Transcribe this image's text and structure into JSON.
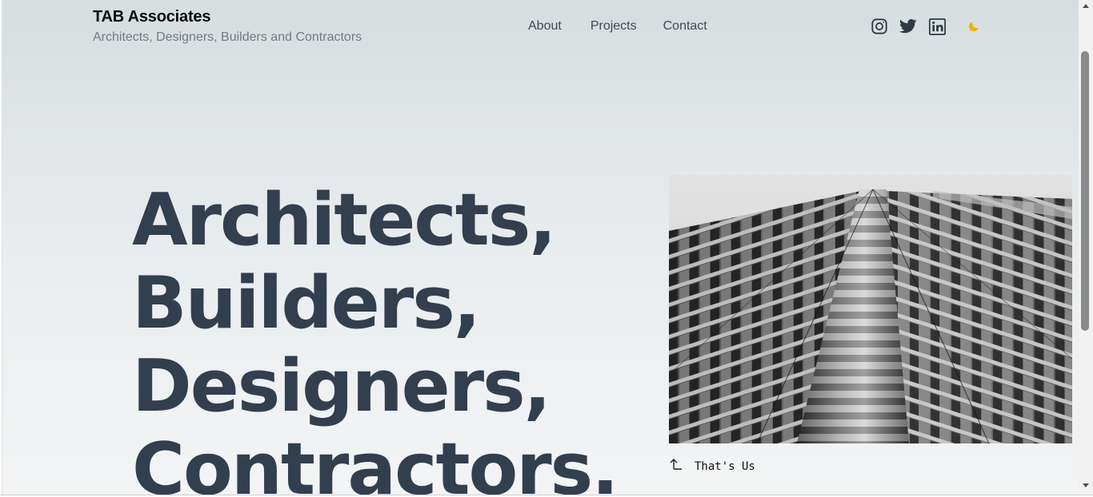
{
  "header": {
    "brand_name": "TAB Associates",
    "tagline": "Architects, Designers, Builders and Contractors"
  },
  "nav": {
    "items": [
      {
        "label": "About"
      },
      {
        "label": "Projects"
      },
      {
        "label": "Contact"
      }
    ]
  },
  "social": {
    "icons": [
      "instagram-icon",
      "twitter-icon",
      "linkedin-icon"
    ],
    "theme_toggle_icon": "moon-icon"
  },
  "hero": {
    "lines": [
      "Architects,",
      "Builders,",
      "Designers,",
      "Contractors."
    ],
    "image_caption": "That's Us",
    "image_subject": "black-and-white skyscraper facade"
  },
  "colors": {
    "heading": "#323f4f",
    "nav_text": "#3f4a55",
    "tagline": "#737b83",
    "moon": "#f0b400",
    "background_top": "#d7dddf",
    "background_bottom": "#f3f4f5"
  }
}
